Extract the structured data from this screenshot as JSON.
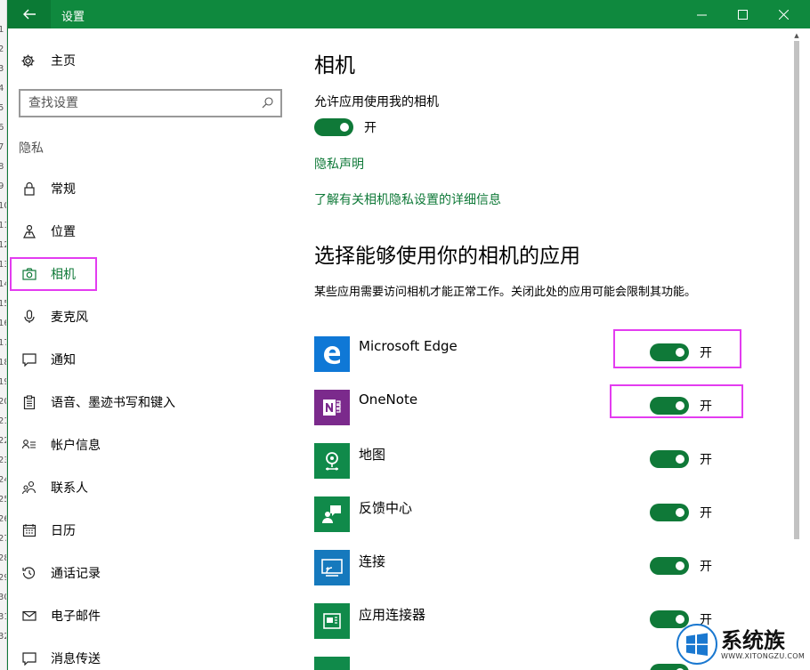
{
  "background_app": {
    "fragments": [
      "1",
      "2",
      "3",
      "4",
      "5",
      "6",
      "7",
      "8",
      "9",
      "10",
      "11",
      "12",
      "13",
      "14",
      "15",
      "16",
      "17",
      "18",
      "19",
      "20",
      "21",
      "22",
      "23",
      "24",
      "25",
      "26",
      "27",
      "28",
      "29",
      "30",
      "31",
      "32"
    ]
  },
  "window": {
    "title": "设置",
    "accent_color": "#0f893e",
    "highlight_color": "#e33cf0"
  },
  "sidebar": {
    "home_label": "主页",
    "search_placeholder": "查找设置",
    "section_label": "隐私",
    "items": [
      {
        "label": "常规",
        "icon": "lock-icon"
      },
      {
        "label": "位置",
        "icon": "location-icon"
      },
      {
        "label": "相机",
        "icon": "camera-icon",
        "active": true
      },
      {
        "label": "麦克风",
        "icon": "microphone-icon"
      },
      {
        "label": "通知",
        "icon": "notification-icon"
      },
      {
        "label": "语音、墨迹书写和键入",
        "icon": "clipboard-icon"
      },
      {
        "label": "帐户信息",
        "icon": "account-info-icon"
      },
      {
        "label": "联系人",
        "icon": "contacts-icon"
      },
      {
        "label": "日历",
        "icon": "calendar-icon"
      },
      {
        "label": "通话记录",
        "icon": "call-history-icon"
      },
      {
        "label": "电子邮件",
        "icon": "mail-icon"
      },
      {
        "label": "消息传送",
        "icon": "messaging-icon"
      }
    ]
  },
  "main": {
    "title": "相机",
    "allow_label": "允许应用使用我的相机",
    "allow_state": "开",
    "privacy_link": "隐私声明",
    "learn_more_link": "了解有关相机隐私设置的详细信息",
    "apps_title": "选择能够使用你的相机的应用",
    "apps_description": "某些应用需要访问相机才能正常工作。关闭此处的应用可能会限制其功能。",
    "apps": [
      {
        "name": "Microsoft Edge",
        "state": "开",
        "icon": "edge-icon"
      },
      {
        "name": "OneNote",
        "state": "开",
        "icon": "onenote-icon"
      },
      {
        "name": "地图",
        "state": "开",
        "icon": "maps-icon"
      },
      {
        "name": "反馈中心",
        "state": "开",
        "icon": "feedback-hub-icon"
      },
      {
        "name": "连接",
        "state": "开",
        "icon": "connect-icon"
      },
      {
        "name": "应用连接器",
        "state": "开",
        "icon": "app-connector-icon"
      },
      {
        "name": "",
        "state": "",
        "icon": "app-icon"
      }
    ]
  },
  "watermark": {
    "text": "系统族",
    "url": "WWW.XITONGZU.COM"
  }
}
